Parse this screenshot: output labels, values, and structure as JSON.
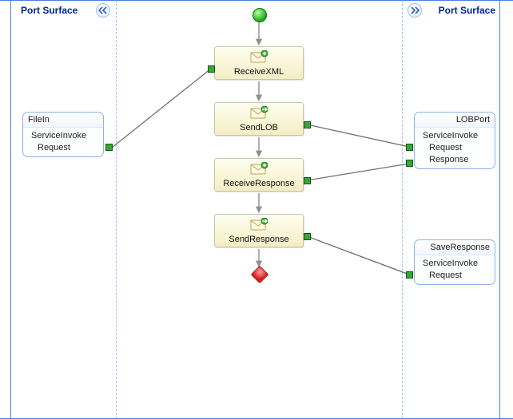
{
  "surface": {
    "left_title": "Port Surface",
    "right_title": "Port Surface"
  },
  "ports_left": {
    "filein": {
      "name": "FileIn",
      "operation": "ServiceInvoke",
      "request": "Request"
    }
  },
  "ports_right": {
    "lobport": {
      "name": "LOBPort",
      "operation": "ServiceInvoke",
      "request": "Request",
      "response": "Response"
    },
    "saveresponse": {
      "name": "SaveResponse",
      "operation": "ServiceInvoke",
      "request": "Request"
    }
  },
  "shapes": {
    "receivexml": {
      "label": "ReceiveXML"
    },
    "sendlob": {
      "label": "SendLOB"
    },
    "recvresponse": {
      "label": "ReceiveResponse"
    },
    "sendresponse": {
      "label": "SendResponse"
    }
  }
}
